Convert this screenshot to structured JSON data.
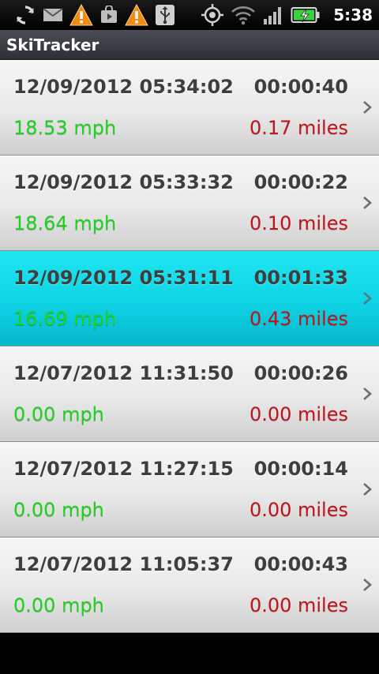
{
  "status_bar": {
    "time": "5:38",
    "icons": [
      "sync-icon",
      "gmail-icon",
      "warning-icon",
      "market-icon",
      "warning-icon",
      "usb-icon",
      "gps-icon",
      "wifi-icon",
      "signal-icon",
      "battery-charging-icon"
    ],
    "accent_green": "#3ed13e"
  },
  "app": {
    "title": "SkiTracker"
  },
  "runs": [
    {
      "datetime": "12/09/2012 05:34:02",
      "duration": "00:00:40",
      "speed": "18.53 mph",
      "distance": "0.17 miles",
      "selected": false
    },
    {
      "datetime": "12/09/2012 05:33:32",
      "duration": "00:00:22",
      "speed": "18.64 mph",
      "distance": "0.10 miles",
      "selected": false
    },
    {
      "datetime": "12/09/2012 05:31:11",
      "duration": "00:01:33",
      "speed": "16.69 mph",
      "distance": "0.43 miles",
      "selected": true
    },
    {
      "datetime": "12/07/2012 11:31:50",
      "duration": "00:00:26",
      "speed": "0.00 mph",
      "distance": "0.00 miles",
      "selected": false
    },
    {
      "datetime": "12/07/2012 11:27:15",
      "duration": "00:00:14",
      "speed": "0.00 mph",
      "distance": "0.00 miles",
      "selected": false
    },
    {
      "datetime": "12/07/2012 11:05:37",
      "duration": "00:00:43",
      "speed": "0.00 mph",
      "distance": "0.00 miles",
      "selected": false
    }
  ],
  "colors": {
    "speed_text": "#1fd21f",
    "distance_text": "#c0141b",
    "selected_row": "#0ed3e4",
    "title_bar": "#3a3c44"
  }
}
